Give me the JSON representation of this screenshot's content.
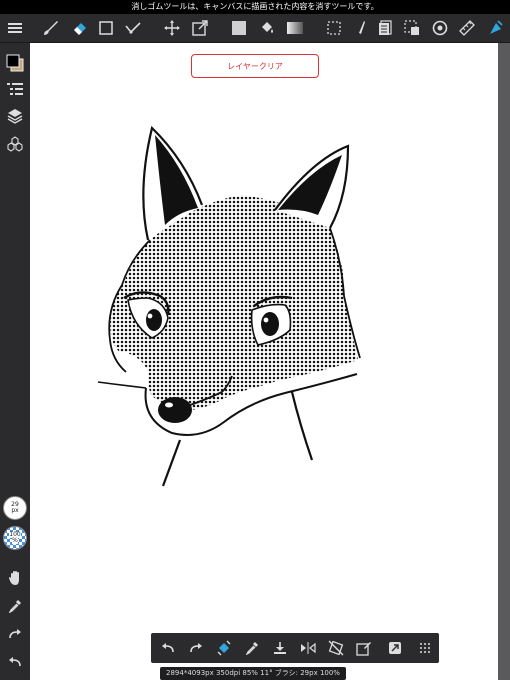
{
  "status": {
    "message": "消しゴムツールは、キャンバスに描画された内容を消すツールです。"
  },
  "top_toolbar": {
    "icons": [
      "menu-icon",
      "brush-icon",
      "eraser-icon",
      "rectangle-icon",
      "checkmark-icon",
      "move-icon",
      "transform-icon",
      "fill-color-icon",
      "bucket-fill-icon",
      "gradient-icon",
      "selection-icon",
      "pen-icon",
      "pages-icon",
      "select-area-icon",
      "dial-icon",
      "ruler-icon",
      "prism-icon"
    ]
  },
  "canvas": {
    "clear_layer_label": "レイヤークリア"
  },
  "left_sidebar": {
    "brush_size": {
      "value": "29",
      "unit": "px"
    },
    "opacity": {
      "value": "100",
      "unit": "%"
    }
  },
  "bottom_toolbar": {
    "icons": [
      "undo-icon",
      "redo-icon",
      "fill-tool-icon",
      "eyedropper-icon",
      "import-icon",
      "flip-icon",
      "no-rotate-icon",
      "edit-layer-icon",
      "export-icon",
      "grid-menu-icon"
    ]
  },
  "info": {
    "text": "2894*4093px 350dpi 85% 11° ブラシ: 29px 100%"
  },
  "colors": {
    "accent": "#2fa6e0",
    "clear_button": "#d8323a",
    "toolbar_bg": "#2b2b2d"
  }
}
